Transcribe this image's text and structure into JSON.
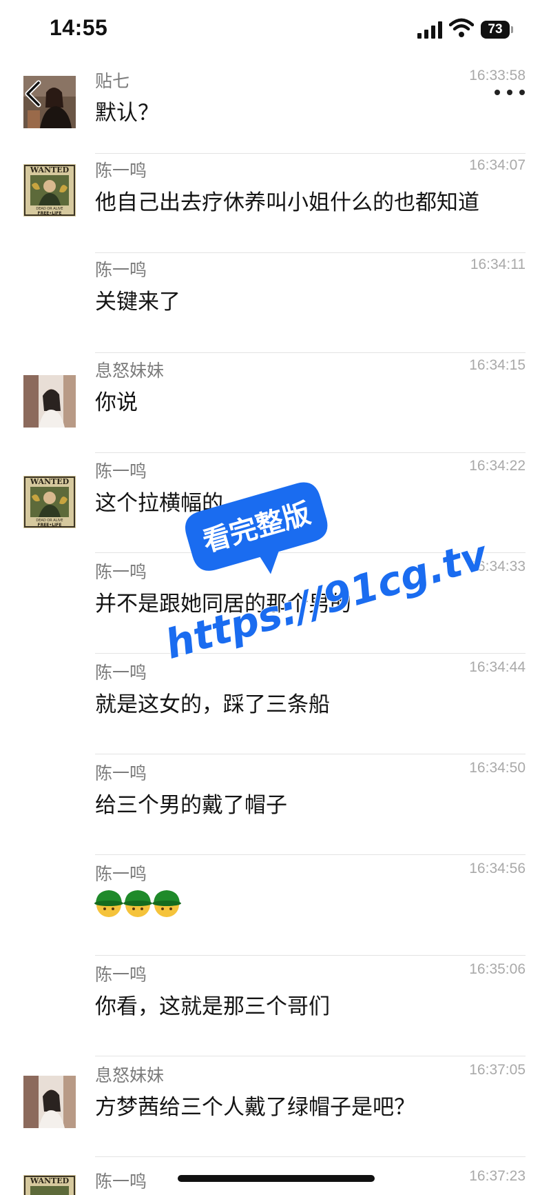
{
  "status_bar": {
    "time": "14:55",
    "battery": "73"
  },
  "header": {
    "back_icon": "chevron-left-icon",
    "more_icon": "more-dots-icon"
  },
  "messages": [
    {
      "sender": "贴七",
      "time": "16:33:58",
      "text": "默认？",
      "avatar": "user-photo-woman-dark"
    },
    {
      "sender": "陈一鸣",
      "time": "16:34:07",
      "text": "他自己出去疗休养叫小姐什么的也都知道",
      "avatar": "wanted-poster"
    },
    {
      "sender": "陈一鸣",
      "time": "16:34:11",
      "text": "关键来了"
    },
    {
      "sender": "息怒妹妹",
      "time": "16:34:15",
      "text": "你说",
      "avatar": "user-photo-woman-light"
    },
    {
      "sender": "陈一鸣",
      "time": "16:34:22",
      "text": "这个拉横幅的",
      "avatar": "wanted-poster"
    },
    {
      "sender": "陈一鸣",
      "time": "16:34:33",
      "text": "并不是跟她同居的那个男的"
    },
    {
      "sender": "陈一鸣",
      "time": "16:34:44",
      "text": "就是这女的，踩了三条船"
    },
    {
      "sender": "陈一鸣",
      "time": "16:34:50",
      "text": "给三个男的戴了帽子"
    },
    {
      "sender": "陈一鸣",
      "time": "16:34:56",
      "text": "",
      "emoji_count": 3,
      "emoji": "green-hat-emoji"
    },
    {
      "sender": "陈一鸣",
      "time": "16:35:06",
      "text": "你看，这就是那三个哥们"
    },
    {
      "sender": "息怒妹妹",
      "time": "16:37:05",
      "text": "方梦茜给三个人戴了绿帽子是吧？",
      "avatar": "user-photo-woman-light"
    },
    {
      "sender": "陈一鸣",
      "time": "16:37:23",
      "text": "",
      "avatar": "wanted-poster"
    }
  ],
  "watermark": {
    "badge": "看完整版",
    "url": "https://91cg.tv",
    "color": "#1a6cf0"
  },
  "avatar_labels": {
    "wanted_title": "WANTED",
    "wanted_sub": "DEAD OR ALIVE",
    "wanted_reward": "FREE•LIFE"
  }
}
